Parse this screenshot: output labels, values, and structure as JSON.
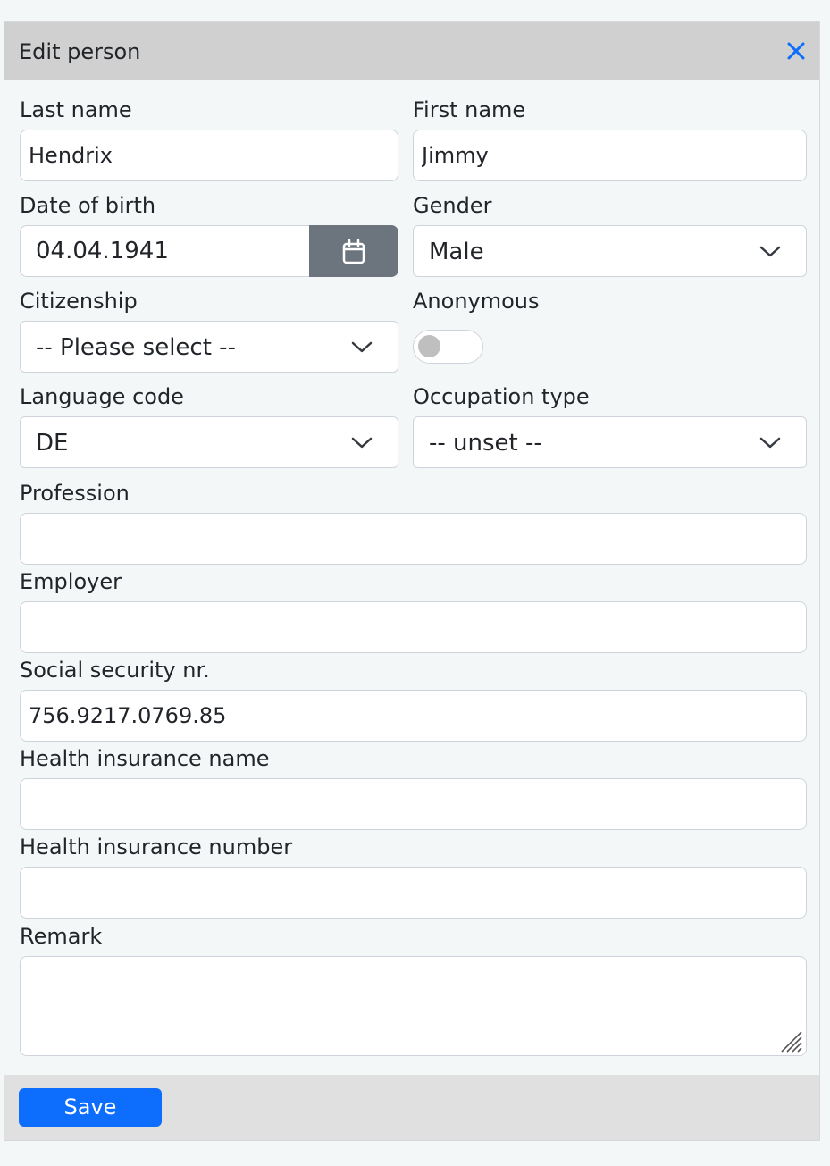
{
  "dialog": {
    "title": "Edit person",
    "close_icon": "close-icon",
    "accent_color": "#0d6efd"
  },
  "fields": {
    "last_name": {
      "label": "Last name",
      "value": "Hendrix"
    },
    "first_name": {
      "label": "First name",
      "value": "Jimmy"
    },
    "date_of_birth": {
      "label": "Date of birth",
      "value": "04.04.1941",
      "icon": "calendar-icon"
    },
    "gender": {
      "label": "Gender",
      "selected": "Male"
    },
    "citizenship": {
      "label": "Citizenship",
      "selected": "-- Please select --"
    },
    "anonymous": {
      "label": "Anonymous",
      "checked": false
    },
    "language_code": {
      "label": "Language code",
      "selected": "DE"
    },
    "occupation_type": {
      "label": "Occupation type",
      "selected": "-- unset --"
    },
    "profession": {
      "label": "Profession",
      "value": ""
    },
    "employer": {
      "label": "Employer",
      "value": ""
    },
    "social_security_nr": {
      "label": "Social security nr.",
      "value": "756.9217.0769.85"
    },
    "health_insurance_name": {
      "label": "Health insurance name",
      "value": ""
    },
    "health_insurance_number": {
      "label": "Health insurance number",
      "value": ""
    },
    "remark": {
      "label": "Remark",
      "value": ""
    }
  },
  "footer": {
    "save_label": "Save"
  }
}
